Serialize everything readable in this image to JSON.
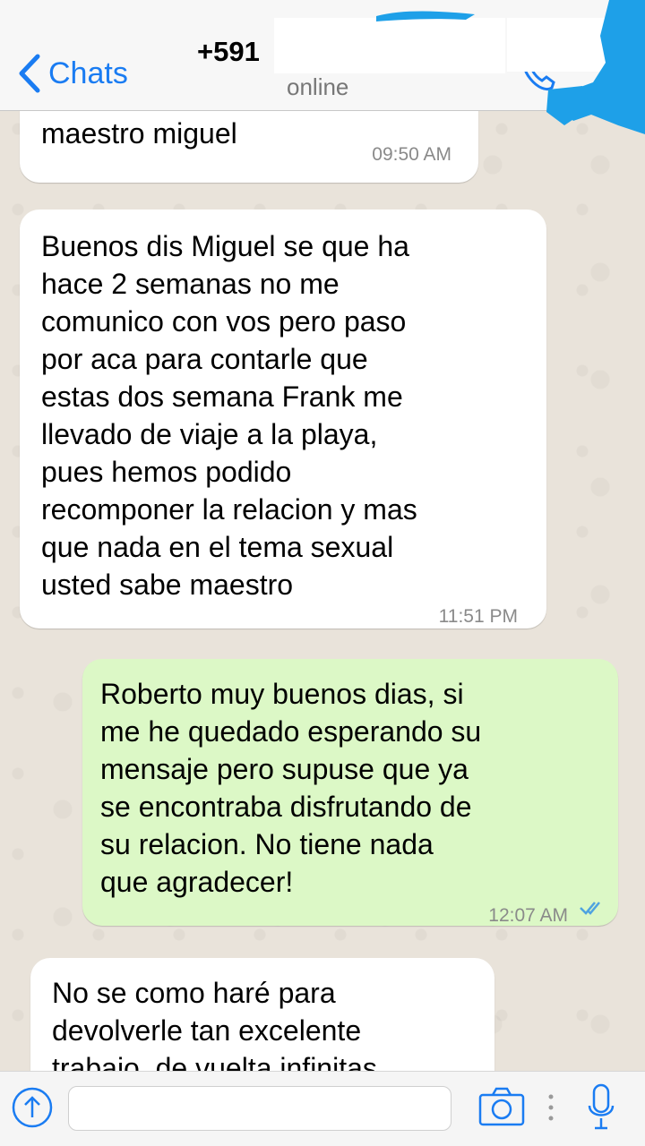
{
  "header": {
    "back_label": "Chats",
    "contact_number": "+591",
    "status": "online"
  },
  "messages": [
    {
      "direction": "in",
      "text": "maestro miguel",
      "time": "09:50 AM"
    },
    {
      "direction": "in",
      "text": "Buenos dis Miguel se que ha\nhace 2 semanas no me\ncomunico con vos pero paso\npor aca para contarle que\nestas dos semana Frank me\nllevado de viaje a la playa,\npues hemos podido\nrecomponer la relacion y mas\nque nada en el tema sexual\nusted sabe maestro",
      "time": "11:51 PM"
    },
    {
      "direction": "out",
      "text": "Roberto muy buenos dias, si\nme he quedado esperando su\nmensaje pero supuse que ya\nse encontraba disfrutando de\nsu relacion. No tiene nada\nque agradecer!",
      "time": "12:07 AM",
      "read": true
    },
    {
      "direction": "in",
      "text": "No se como haré para\ndevolverle tan excelente\ntrabajo, de vuelta infinitas",
      "time": ""
    }
  ],
  "input": {
    "value": "",
    "placeholder": ""
  },
  "colors": {
    "accent": "#1a7cf2",
    "outgoing_bubble": "#dcf8c6",
    "incoming_bubble": "#ffffff",
    "read_ticks": "#4fa3e0",
    "scribble": "#1ea0e8"
  },
  "icons": {
    "back": "chevron-left-icon",
    "upload": "upload-icon",
    "camera": "camera-icon",
    "mic": "microphone-icon",
    "read": "double-check-icon"
  }
}
